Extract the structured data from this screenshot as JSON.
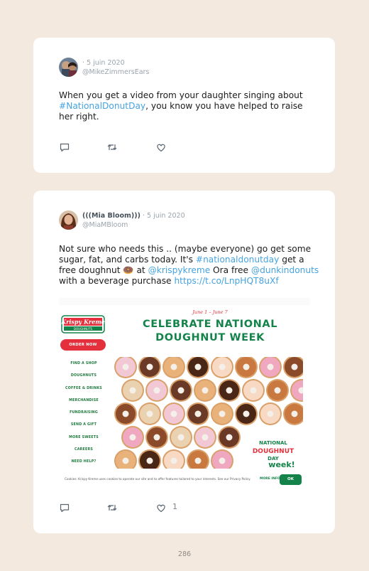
{
  "tweets": [
    {
      "display_name": "",
      "separator": "·",
      "date": "5 juin 2020",
      "handle": "@MikeZimmersEars",
      "text_1": "When you get a video from your daughter singing about ",
      "hashtag": "#NationalDonutDay",
      "text_2": ", you know you have helped to raise her right.",
      "like_count": ""
    },
    {
      "display_name": "(((Mia Bloom)))",
      "separator": "·",
      "date": "5 juin 2020",
      "handle": "@MiaMBloom",
      "text_1": "Not sure who needs this .. (maybe everyone) go get some sugar, fat, and carbs today. It's ",
      "hashtag": "#nationaldonutday",
      "text_2": " get a free doughnut ",
      "emoji": "🍩",
      "text_3": " at ",
      "mention_1": "@krispykreme",
      "text_4": " Ora free ",
      "mention_2": "@dunkindonuts",
      "text_5": " with a beverage purchase ",
      "url": "https://t.co/LnpHQT8uXf",
      "like_count": "1"
    }
  ],
  "embedded_image": {
    "logo_text": "Krispy Kreme",
    "logo_sub": "DOUGHNUTS",
    "order_button": "ORDER NOW",
    "nav_items": [
      "FIND A SHOP",
      "DOUGHNUTS",
      "COFFEE & DRINKS",
      "MERCHANDISE",
      "FUNDRAISING",
      "SEND A GIFT",
      "MORE SWEETS",
      "CAREERS",
      "NEED HELP?"
    ],
    "dates": "June 1 – June 7",
    "headline_1": "CELEBRATE NATIONAL",
    "headline_2": "DOUGHNUT WEEK",
    "badge_line_1": "NATIONAL",
    "badge_line_2": "DOUGHNUT",
    "badge_line_3": "DAY",
    "badge_line_4": "week!",
    "cookie_text": "Cookies: Krispy Kreme uses cookies to operate our site and to offer features tailored to your interests. See our Privacy Policy.",
    "cookie_more": "MORE INFO",
    "cookie_ok": "OK",
    "colors": {
      "brand_green": "#13834a",
      "brand_red": "#e4303c"
    }
  },
  "page_number": "286",
  "icons": [
    "reply-icon",
    "retweet-icon",
    "like-icon"
  ]
}
